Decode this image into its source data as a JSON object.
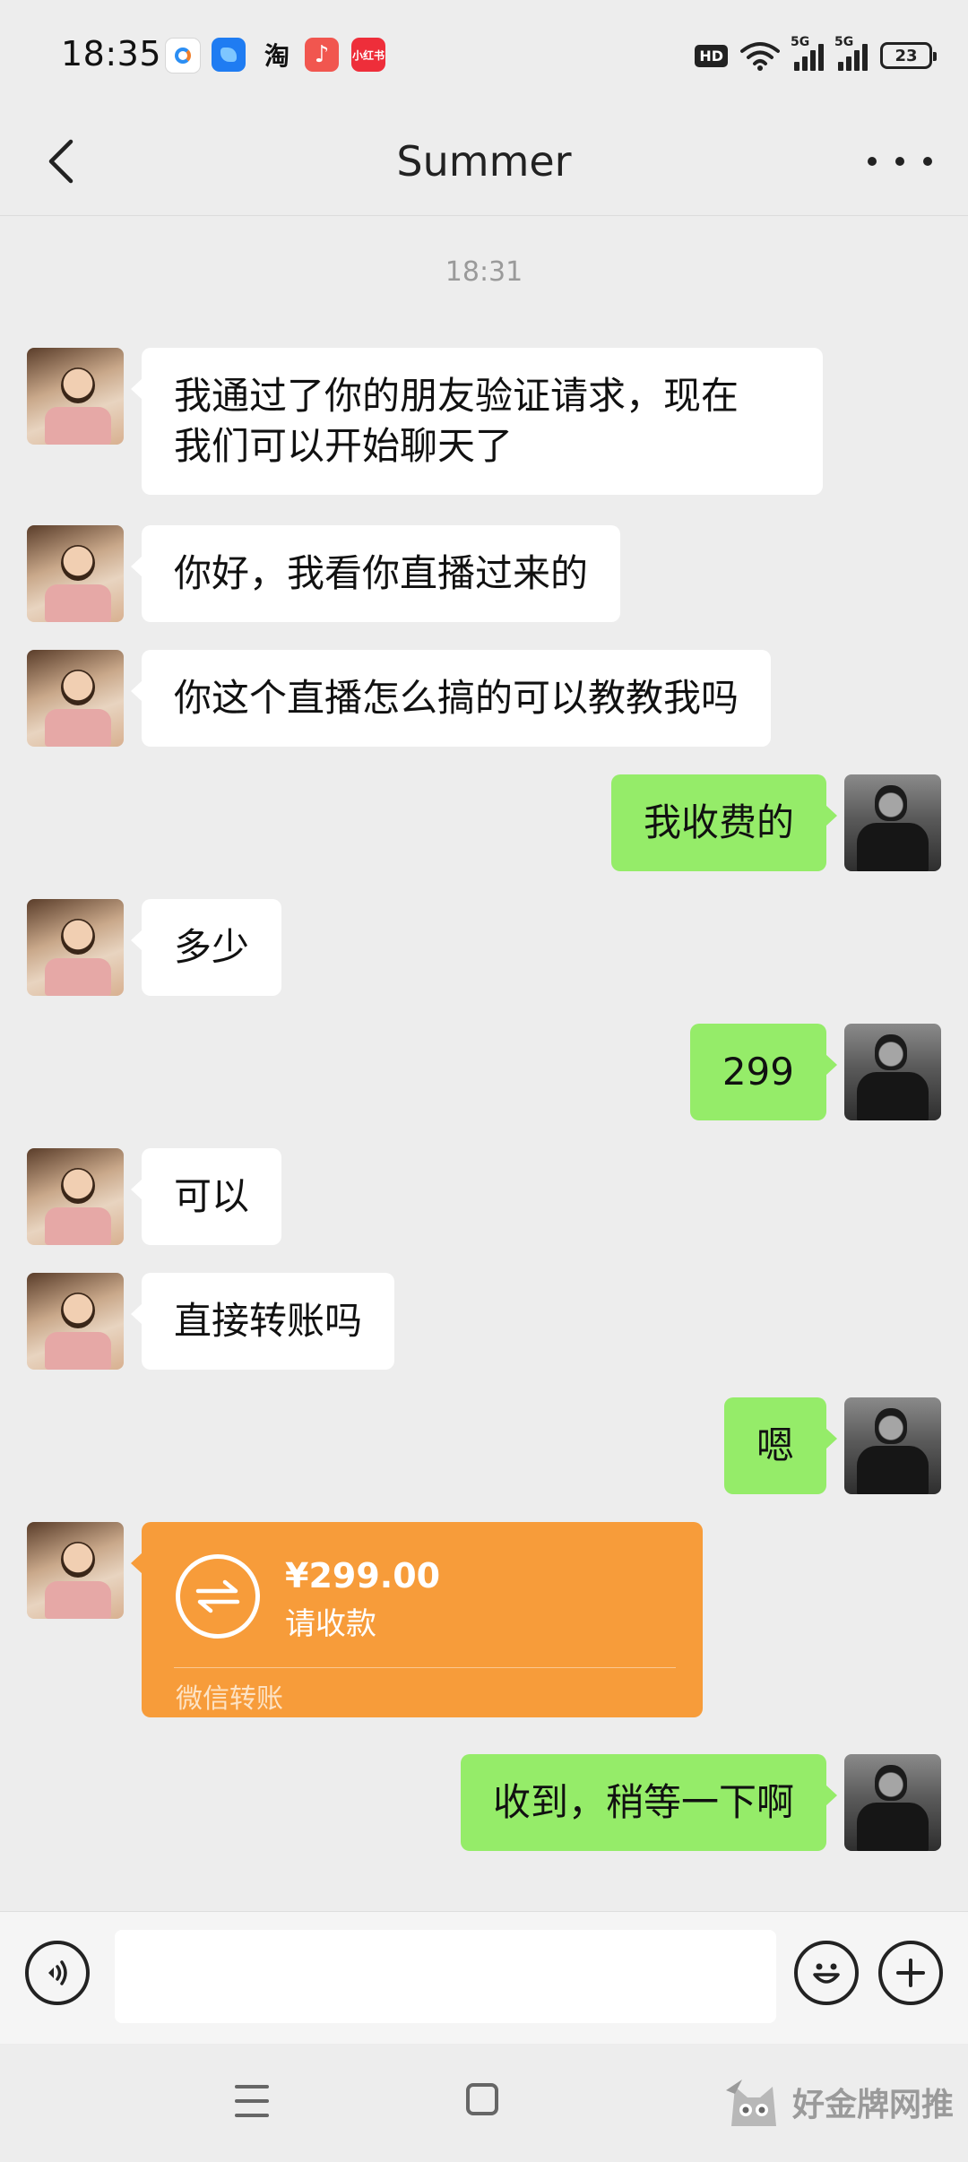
{
  "status_bar": {
    "time": "18:35",
    "notification_icons": [
      "map-app-icon",
      "cloud-app-icon",
      "taobao-icon",
      "music-app-icon",
      "xiaohongshu-icon"
    ],
    "taobao_glyph": "淘",
    "xiaohongshu_label": "小红书",
    "hd_label": "HD",
    "signal_1_label": "5G",
    "signal_2_label": "5G",
    "battery_level": "23"
  },
  "nav": {
    "title": "Summer"
  },
  "chat": {
    "timestamp": "18:31",
    "messages": [
      {
        "from": "them",
        "text_line1": "我通过了你的朋友验证请求，现在",
        "text_line2": "我们可以开始聊天了"
      },
      {
        "from": "them",
        "text": "你好，我看你直播过来的"
      },
      {
        "from": "them",
        "text": "你这个直播怎么搞的可以教教我吗"
      },
      {
        "from": "me",
        "text": "我收费的"
      },
      {
        "from": "them",
        "text": "多少"
      },
      {
        "from": "me",
        "text": "299"
      },
      {
        "from": "them",
        "text": "可以"
      },
      {
        "from": "them",
        "text": "直接转账吗"
      },
      {
        "from": "me",
        "text": "嗯"
      },
      {
        "from": "them",
        "type": "transfer",
        "amount": "¥299.00",
        "status": "请收款",
        "footer": "微信转账"
      },
      {
        "from": "me",
        "text": "收到，稍等一下啊"
      }
    ]
  },
  "input_bar": {
    "value": "",
    "placeholder": ""
  },
  "watermark": {
    "text": "好金牌网推"
  },
  "colors": {
    "background": "#ededed",
    "my_bubble": "#95ec69",
    "their_bubble": "#ffffff",
    "transfer_card": "#f79c3a"
  }
}
